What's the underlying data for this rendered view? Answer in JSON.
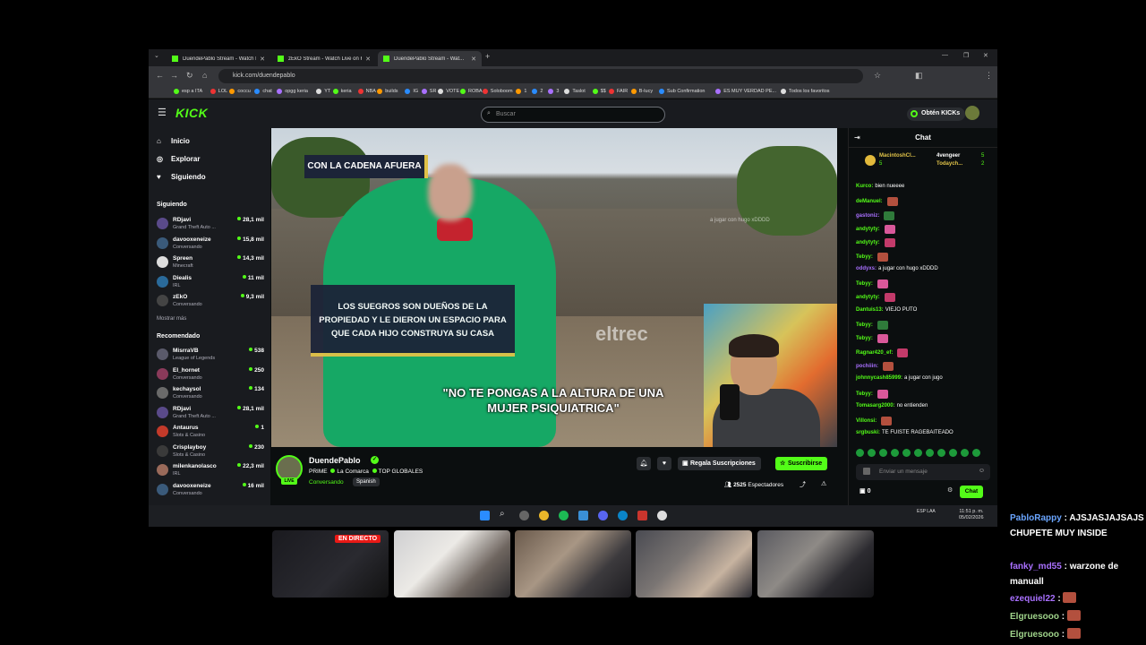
{
  "browser": {
    "tabs": [
      {
        "label": "DuendePablo Stream - Watch L..."
      },
      {
        "label": "zEkO Stream - Watch Live on K..."
      },
      {
        "label": "DuendePablo Stream - Wat..."
      }
    ],
    "url": "kick.com/duendepablo",
    "bookmarks": [
      "esp a ITA",
      "LOL",
      "coccu",
      "chat",
      "opgg keria",
      "YT",
      "keria",
      "NBA",
      "builds",
      "IG",
      "SR",
      "VOTE",
      "ROBA",
      "Soloboom",
      "1",
      "2",
      "3",
      "Taslot",
      "$$",
      "FAIR",
      "B-lucy",
      "Sub Confirmation",
      "ES MUY VERDAD PE...",
      "Todos los favoritos"
    ]
  },
  "kick": {
    "logo": "KICK",
    "search_placeholder": "Buscar",
    "get_kicks": "Obtén KICKs",
    "nav": {
      "home": "Inicio",
      "explore": "Explorar",
      "following": "Siguiendo"
    },
    "following_heading": "Siguiendo",
    "following": [
      {
        "name": "RDjavi",
        "category": "Grand Theft Auto ...",
        "viewers": "28,1 mil",
        "color": "#5a4a8a"
      },
      {
        "name": "davooxeneize",
        "category": "Conversando",
        "viewers": "15,8 mil",
        "color": "#3a5a7a"
      },
      {
        "name": "Spreen",
        "category": "Minecraft",
        "viewers": "14,3 mil",
        "color": "#dddddd"
      },
      {
        "name": "Diealis",
        "category": "IRL",
        "viewers": "11 mil",
        "color": "#2a6a9a"
      },
      {
        "name": "zEkO",
        "category": "Conversando",
        "viewers": "9,3 mil",
        "color": "#444444"
      }
    ],
    "show_more": "Mostrar más",
    "recommended_heading": "Recomendado",
    "recommended": [
      {
        "name": "MisrraVB",
        "category": "League of Legends",
        "viewers": "538",
        "color": "#5a5a6a"
      },
      {
        "name": "El_hornet",
        "category": "Conversando",
        "viewers": "250",
        "color": "#8a3a5a"
      },
      {
        "name": "kechaysol",
        "category": "Conversando",
        "viewers": "134",
        "color": "#6a6a6a"
      },
      {
        "name": "RDjavi",
        "category": "Grand Theft Auto ...",
        "viewers": "28,1 mil",
        "color": "#5a4a8a"
      },
      {
        "name": "Antaurus",
        "category": "Slots & Casino",
        "viewers": "1",
        "color": "#c33a2a"
      },
      {
        "name": "Crisplayboy",
        "category": "Slots & Casino",
        "viewers": "230",
        "color": "#3a3a3a"
      },
      {
        "name": "milenkanolasco",
        "category": "IRL",
        "viewers": "22,3 mil",
        "color": "#9a6a5a"
      },
      {
        "name": "davooxeneize",
        "category": "Conversando",
        "viewers": "16 mil",
        "color": "#3a5a7a"
      }
    ]
  },
  "video": {
    "caption_top": "CON LA CADENA AFUERA",
    "caption_mid": "LOS SUEGROS SON DUEÑOS DE LA PROPIEDAD Y LE DIERON UN ESPACIO PARA QUE CADA HIJO CONSTRUYA SU CASA",
    "caption_quote": "\"NO TE PONGAS A LA ALTURA DE UNA MUJER PSIQUIATRICA\"",
    "watermark": "eltrec",
    "ghost_text": "a jugar con hugo xDDDD"
  },
  "stream": {
    "streamer": "DuendePablo",
    "live_badge": "LIVE",
    "title_parts": [
      "PRIME",
      "La Comarca",
      "TOP GLOBALES"
    ],
    "category": "Conversando",
    "tag": "Spanish",
    "gift_subs": "Regala Suscripciones",
    "subscribe": "Suscribirse",
    "viewers_count": "2525",
    "viewers_label": "Espectadores"
  },
  "chat": {
    "title": "Chat",
    "pinned": [
      {
        "name": "MacintoshCl...",
        "count": "5"
      },
      {
        "name": "4vengeer",
        "count": "5"
      },
      {
        "name": "Todaych...",
        "count": "2"
      }
    ],
    "messages": [
      {
        "user": "Kurco:",
        "text": "bien nueeee",
        "color": "#53fc18"
      },
      {
        "user": "deManuel:",
        "text": "",
        "color": "#53fc18",
        "emote": true
      },
      {
        "user": "gastoniz:",
        "text": "",
        "color": "#a970ff",
        "emote": true
      },
      {
        "user": "andytyty:",
        "text": "",
        "color": "#53fc18",
        "emote": true
      },
      {
        "user": "andytyty:",
        "text": "",
        "color": "#53fc18",
        "emote": true
      },
      {
        "user": "Tebyy:",
        "text": "",
        "color": "#53fc18",
        "emote": true
      },
      {
        "user": "oddyxs:",
        "text": "a jugar con hugo xDDDD",
        "color": "#a970ff"
      },
      {
        "user": "Tebyy:",
        "text": "",
        "color": "#53fc18",
        "emote": true
      },
      {
        "user": "andytyty:",
        "text": "",
        "color": "#53fc18",
        "emote": true
      },
      {
        "user": "Dantuis13:",
        "text": "VIEJO PUTO",
        "color": "#53fc18"
      },
      {
        "user": "Tebyy:",
        "text": "",
        "color": "#53fc18",
        "emote": true
      },
      {
        "user": "Tebyy:",
        "text": "",
        "color": "#53fc18",
        "emote": true
      },
      {
        "user": "Ragnar420_ef:",
        "text": "",
        "color": "#53fc18",
        "emote": true
      },
      {
        "user": "pochiiin:",
        "text": "",
        "color": "#a970ff",
        "emote": true
      },
      {
        "user": "johnnycash85999:",
        "text": "a jugar con jugo",
        "color": "#53fc18"
      },
      {
        "user": "Tebyy:",
        "text": "",
        "color": "#53fc18",
        "emote": true
      },
      {
        "user": "Tomasarg2000:",
        "text": "no entienden",
        "color": "#53fc18"
      },
      {
        "user": "Villonsi:",
        "text": "",
        "color": "#53fc18",
        "emote": true
      },
      {
        "user": "srgbuski:",
        "text": "TE FUISTE RAGEBAITEADO",
        "color": "#53fc18"
      }
    ],
    "input_placeholder": "Enviar un mensaje",
    "kick_count": "0",
    "send": "Chat"
  },
  "taskbar": {
    "lang": "ESP LAA",
    "time": "11:51 p. m.",
    "date": "05/02/2026"
  },
  "bottom": {
    "live_badge": "EN DIRECTO"
  },
  "overlay_chat": [
    {
      "user": "PabloRappy",
      "text": "AJSJASJAJSAJS CHUPETE MUY INSIDE",
      "color": "#6aa5ff"
    },
    {
      "user": "fanky_md55",
      "text": "warzone de manuall",
      "color": "#a970ff"
    },
    {
      "user": "ezequiel22",
      "text": "",
      "color": "#a970ff"
    },
    {
      "user": "Elgruesooo",
      "text": "",
      "color": "#9fd38a"
    },
    {
      "user": "Elgruesooo",
      "text": "",
      "color": "#9fd38a"
    }
  ]
}
